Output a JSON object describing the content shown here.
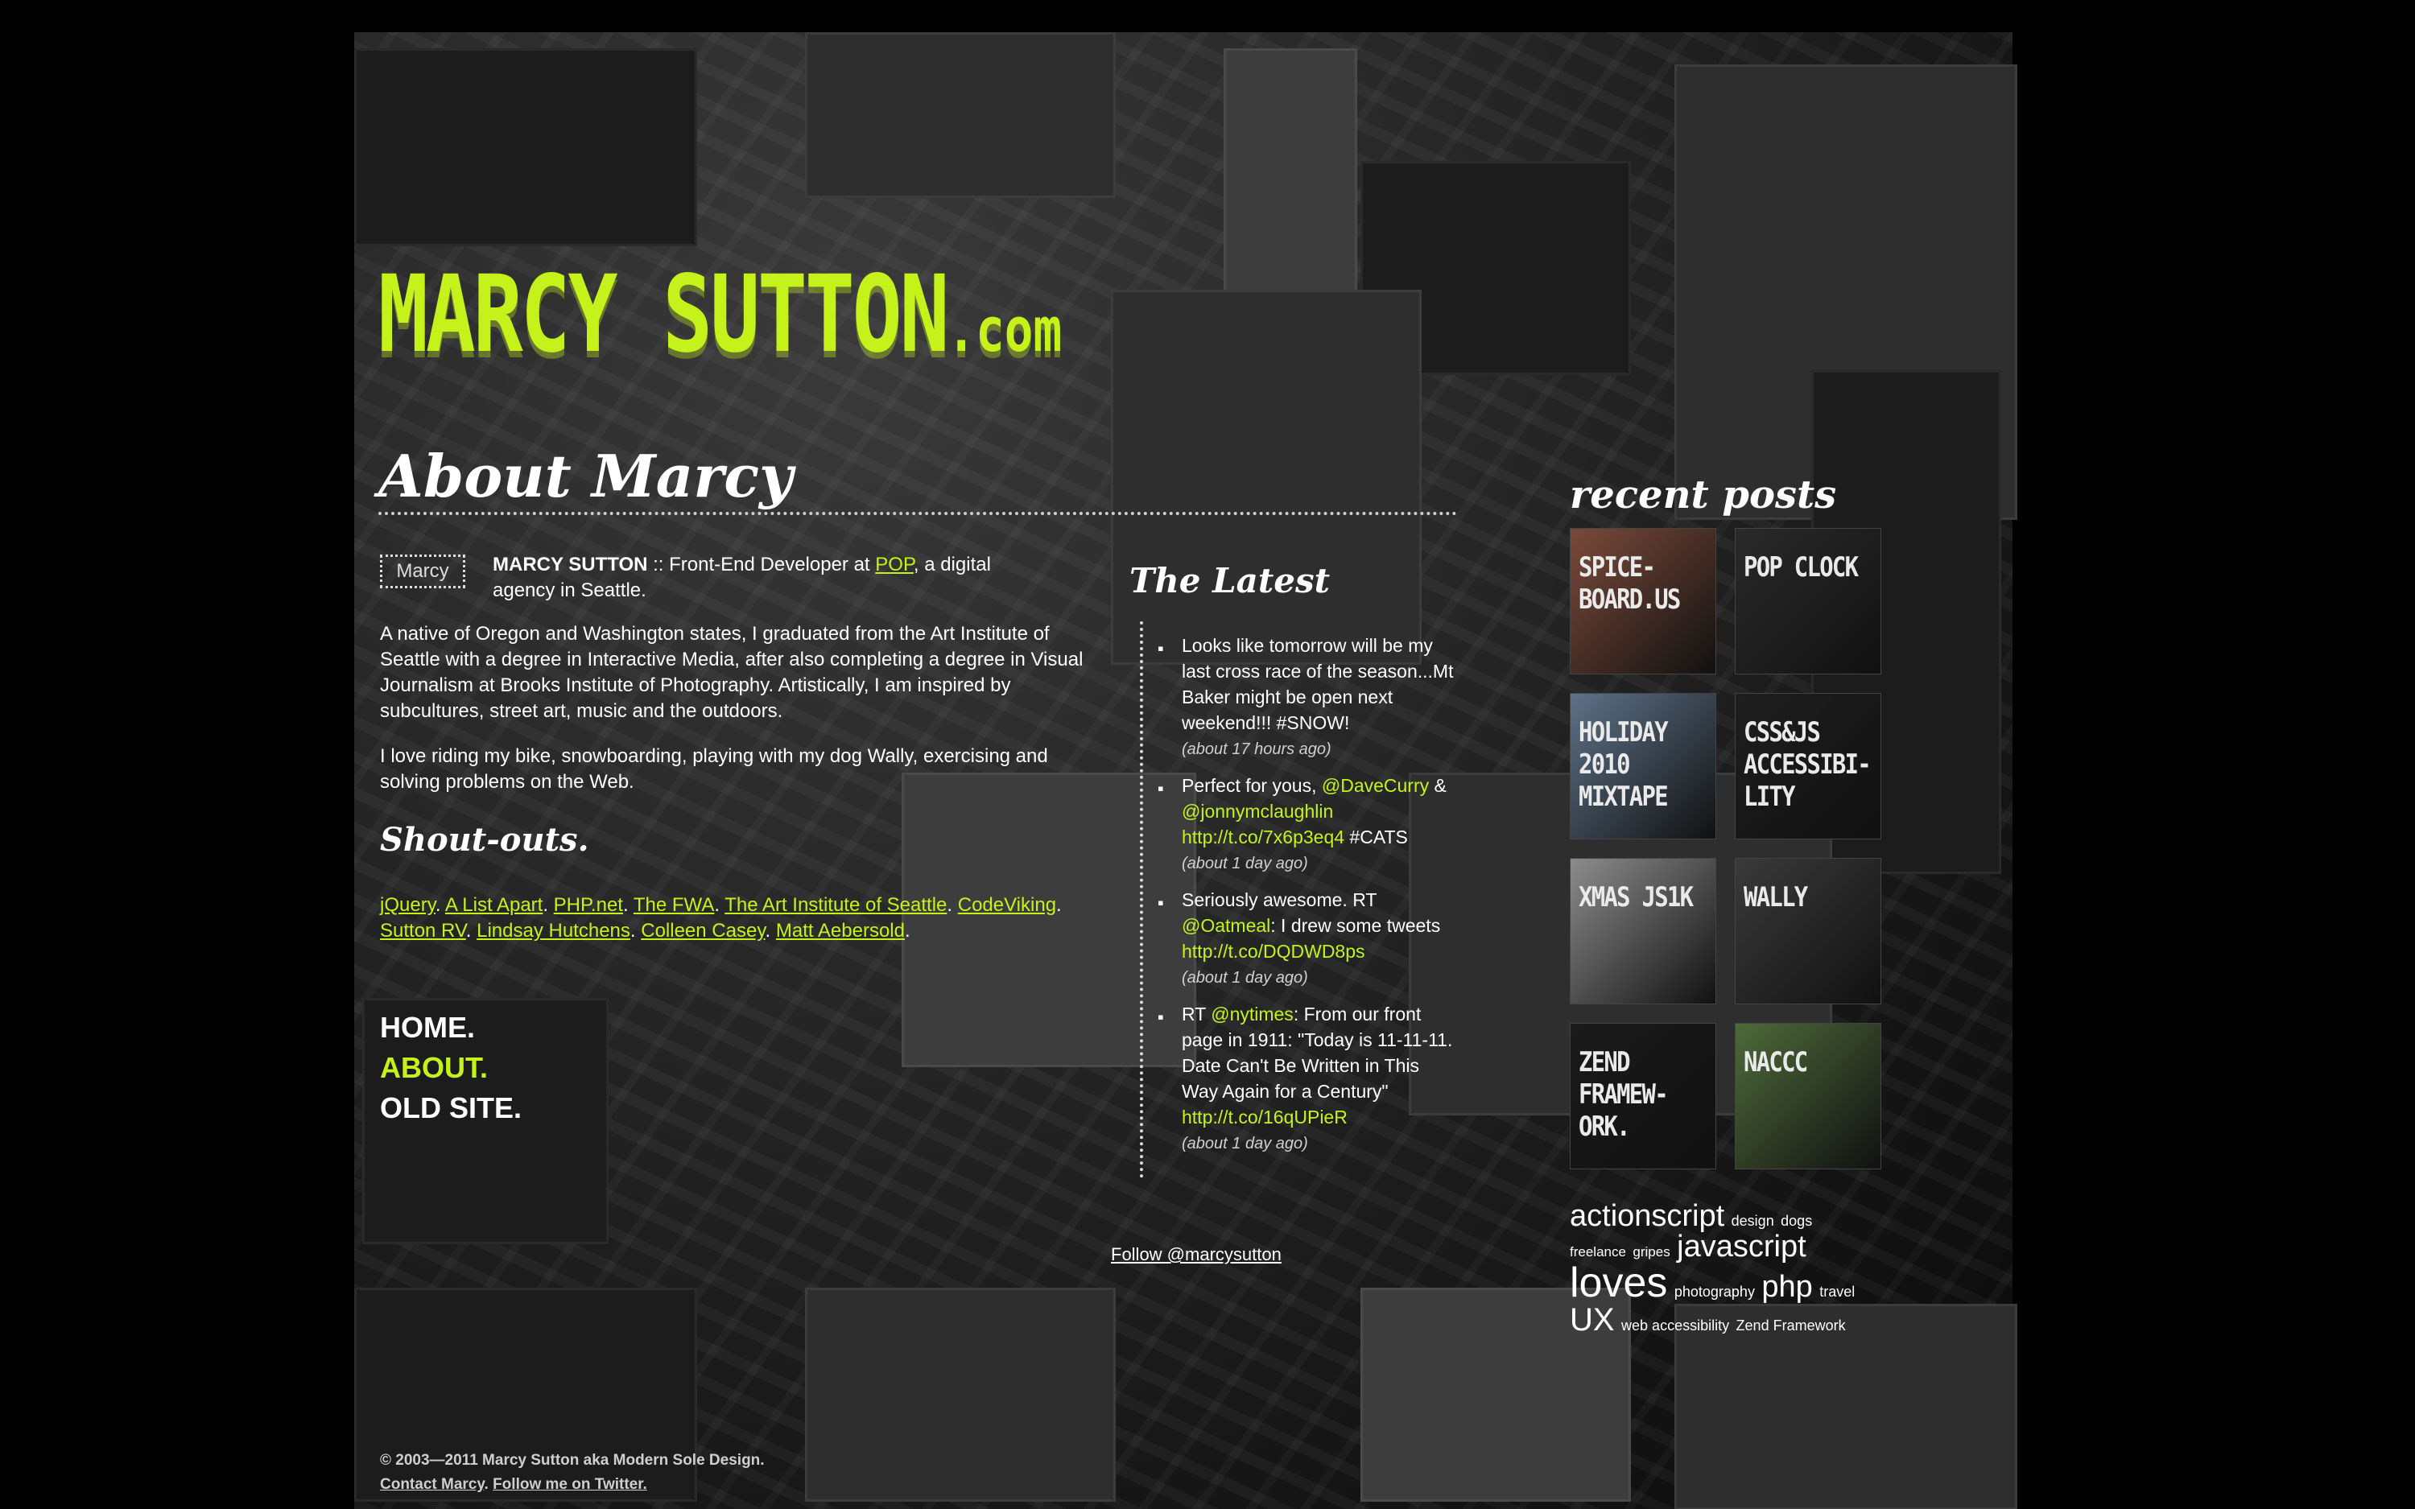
{
  "site": {
    "logo_main": "MARCY SUTTON",
    "logo_suffix": ".com"
  },
  "about": {
    "title": "About Marcy",
    "avatar_alt": "Marcy",
    "intro_name": "MARCY SUTTON",
    "intro_sep": " :: Front-End Developer at ",
    "intro_link": "POP",
    "intro_rest": ", a digital agency in Seattle.",
    "paragraph1": "A native of Oregon and Washington states, I graduated from the Art Institute of Seattle with a degree in Interactive Media, after also completing a degree in Visual Journalism at Brooks Institute of Photography. Artistically, I am inspired by subcultures, street art, music and the outdoors.",
    "paragraph2": "I love riding my bike, snowboarding, playing with my dog Wally, exercising and solving problems on the Web."
  },
  "shoutouts": {
    "title": "Shout-outs.",
    "links": [
      "jQuery",
      "A List Apart",
      "PHP.net",
      "The FWA",
      "The Art Institute of Seattle",
      "CodeViking",
      "Sutton RV",
      "Lindsay Hutchens",
      "Colleen Casey",
      "Matt Aebersold"
    ]
  },
  "nav": {
    "items": [
      "HOME.",
      "ABOUT.",
      "OLD SITE."
    ],
    "active": "ABOUT."
  },
  "latest": {
    "title": "The Latest",
    "tweets": [
      {
        "parts": [
          {
            "t": "Looks like tomorrow will be my last cross race of the season...Mt Baker might be open next weekend!!! #SNOW!",
            "link": false
          }
        ],
        "time": "(about 17 hours ago)"
      },
      {
        "parts": [
          {
            "t": "Perfect for yous, ",
            "link": false
          },
          {
            "t": "@DaveCurry",
            "link": true
          },
          {
            "t": " & ",
            "link": false
          },
          {
            "t": "@jonnymclaughlin",
            "link": true
          },
          {
            "t": " ",
            "link": false
          },
          {
            "t": "http://t.co/7x6p3eq4",
            "link": true
          },
          {
            "t": " #CATS",
            "link": false
          }
        ],
        "time": "(about 1 day ago)"
      },
      {
        "parts": [
          {
            "t": "Seriously awesome. RT ",
            "link": false
          },
          {
            "t": "@Oatmeal",
            "link": true
          },
          {
            "t": ": I drew some tweets ",
            "link": false
          },
          {
            "t": "http://t.co/DQDWD8ps",
            "link": true
          }
        ],
        "time": "(about 1 day ago)"
      },
      {
        "parts": [
          {
            "t": "RT ",
            "link": false
          },
          {
            "t": "@nytimes",
            "link": true
          },
          {
            "t": ": From our front page in 1911: \"Today is 11-11-11. Date Can't Be Written in This Way Again for a Century\" ",
            "link": false
          },
          {
            "t": "http://t.co/16qUPieR",
            "link": true
          }
        ],
        "time": "(about 1 day ago)"
      }
    ],
    "follow_label": "Follow @marcysutton"
  },
  "recent_posts": {
    "title": "recent posts",
    "thumbs": [
      {
        "label": "SPICE-BOARD.US",
        "bg": "#7a4a3a"
      },
      {
        "label": "POP CLOCK",
        "bg": "#2a2a2a"
      },
      {
        "label": "HOLIDAY 2010 MIXTAPE",
        "bg": "#5e7288"
      },
      {
        "label": "CSS&JS ACCESSIBI-LITY",
        "bg": "#1e1e1e"
      },
      {
        "label": "XMAS JS1K",
        "bg": "#8c8c8c"
      },
      {
        "label": "WALLY",
        "bg": "#3a3a3a"
      },
      {
        "label": "ZEND FRAMEW-ORK.",
        "bg": "#1a1a1a"
      },
      {
        "label": "NACCC",
        "bg": "#4e6a3a"
      }
    ]
  },
  "tags": [
    {
      "t": "actionscript",
      "s": 38
    },
    {
      "t": "design",
      "s": 18
    },
    {
      "t": "dogs",
      "s": 18
    },
    {
      "t": "freelance",
      "s": 17
    },
    {
      "t": "gripes",
      "s": 17
    },
    {
      "t": "javascript",
      "s": 38
    },
    {
      "t": "loves",
      "s": 52
    },
    {
      "t": "photography",
      "s": 18
    },
    {
      "t": "php",
      "s": 38
    },
    {
      "t": "travel",
      "s": 18
    },
    {
      "t": "UX",
      "s": 40
    },
    {
      "t": "web accessibility",
      "s": 18
    },
    {
      "t": "Zend Framework",
      "s": 18
    }
  ],
  "footer": {
    "copyright": "© 2003—2011 Marcy Sutton aka Modern Sole Design.",
    "contact": "Contact Marcy",
    "twitter": "Follow me on Twitter."
  },
  "colors": {
    "accent": "#c5f21a",
    "background": "#000000",
    "text": "#ffffff"
  }
}
